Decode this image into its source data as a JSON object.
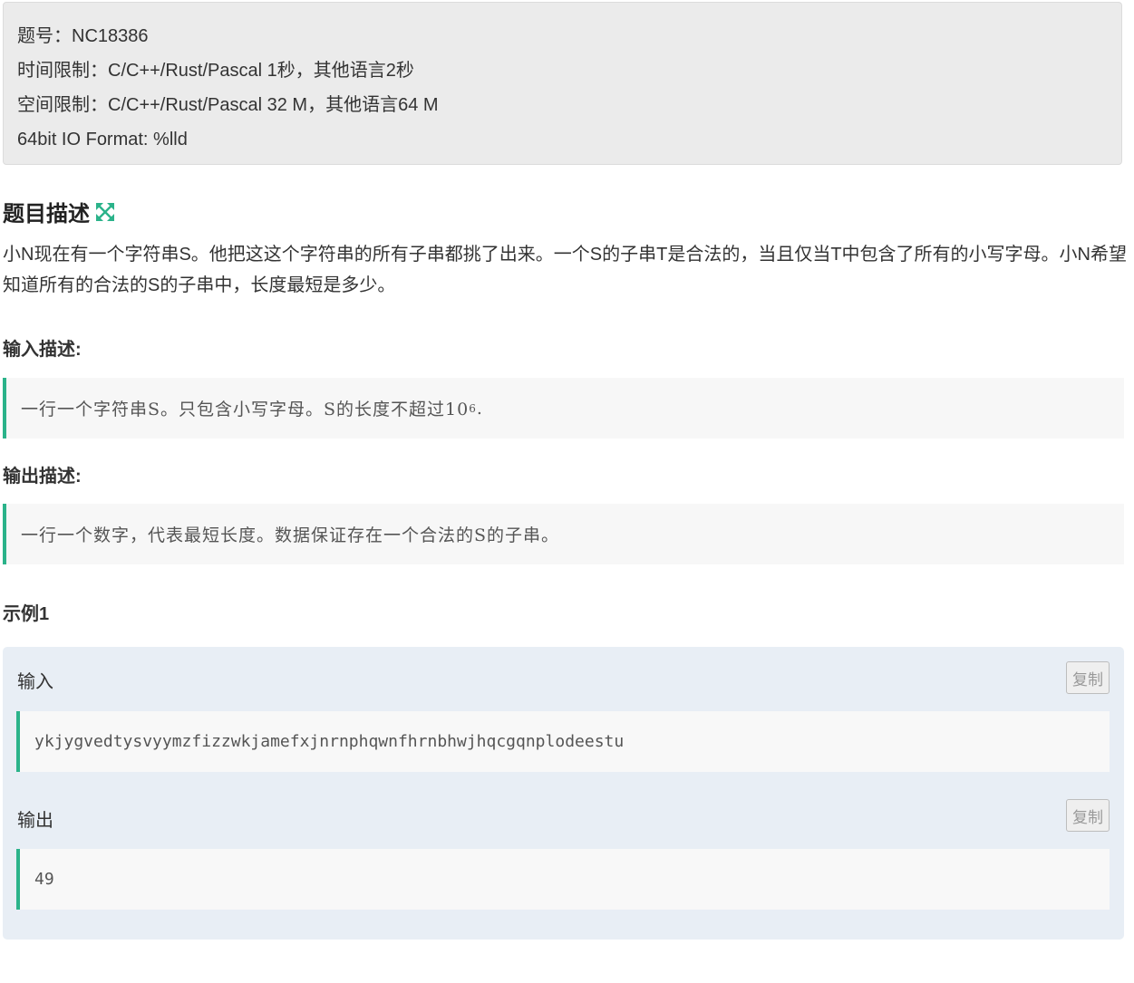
{
  "meta": {
    "problem_id": "题号：NC18386",
    "time_limit": "时间限制：C/C++/Rust/Pascal 1秒，其他语言2秒",
    "memory_limit": "空间限制：C/C++/Rust/Pascal 32 M，其他语言64 M",
    "io_format": "64bit IO Format: %lld"
  },
  "description": {
    "title": "题目描述",
    "icon": "expand-icon",
    "accent_color": "#2bb38a",
    "text": "小N现在有一个字符串S。他把这这个字符串的所有子串都挑了出来。一个S的子串T是合法的，当且仅当T中包含了所有的小写字母。小N希望知道所有的合法的S的子串中，长度最短是多少。"
  },
  "input_desc": {
    "title": "输入描述:",
    "text": "一行一个字符串S。只包含小写字母。S的长度不超过10",
    "exponent": "6",
    "suffix": "."
  },
  "output_desc": {
    "title": "输出描述:",
    "text": "一行一个数字，代表最短长度。数据保证存在一个合法的S的子串。"
  },
  "example": {
    "title": "示例1",
    "input_label": "输入",
    "input_value": "ykjygvedtysvyymzfizzwkjamefxjnrnphqwnfhrnbhwjhqcgqnplodeestu",
    "output_label": "输出",
    "output_value": "49",
    "copy_label": "复制"
  }
}
